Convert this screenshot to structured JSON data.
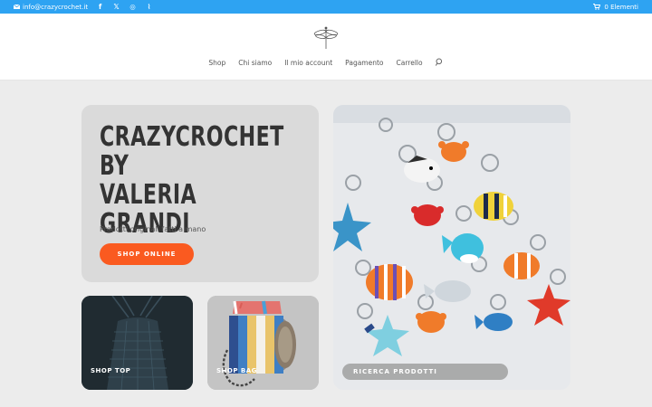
{
  "topbar": {
    "email": "info@crazycrochet.it",
    "social": [
      {
        "name": "facebook-icon",
        "glyph": "f"
      },
      {
        "name": "x-icon",
        "glyph": "𝕏"
      },
      {
        "name": "instagram-icon",
        "glyph": "◎"
      },
      {
        "name": "rss-icon",
        "glyph": "⌇"
      }
    ],
    "cart_label": "0 Elementi"
  },
  "nav": {
    "items": [
      "Shop",
      "Chi siamo",
      "Il mio account",
      "Pagamento",
      "Carrello"
    ]
  },
  "hero": {
    "title_lines": [
      "CRAZYCROCHET",
      "BY",
      "VALERIA GRANDI"
    ],
    "tagline": "Prodotti originali fatti a mano",
    "button": "SHOP ONLINE"
  },
  "cards": {
    "top_label": "SHOP TOP",
    "bag_label": "SHOP BAG",
    "search_label": "RICERCA PRODOTTI"
  },
  "colors": {
    "topbar": "#2ea3f2",
    "accent_button": "#fa5a20"
  }
}
